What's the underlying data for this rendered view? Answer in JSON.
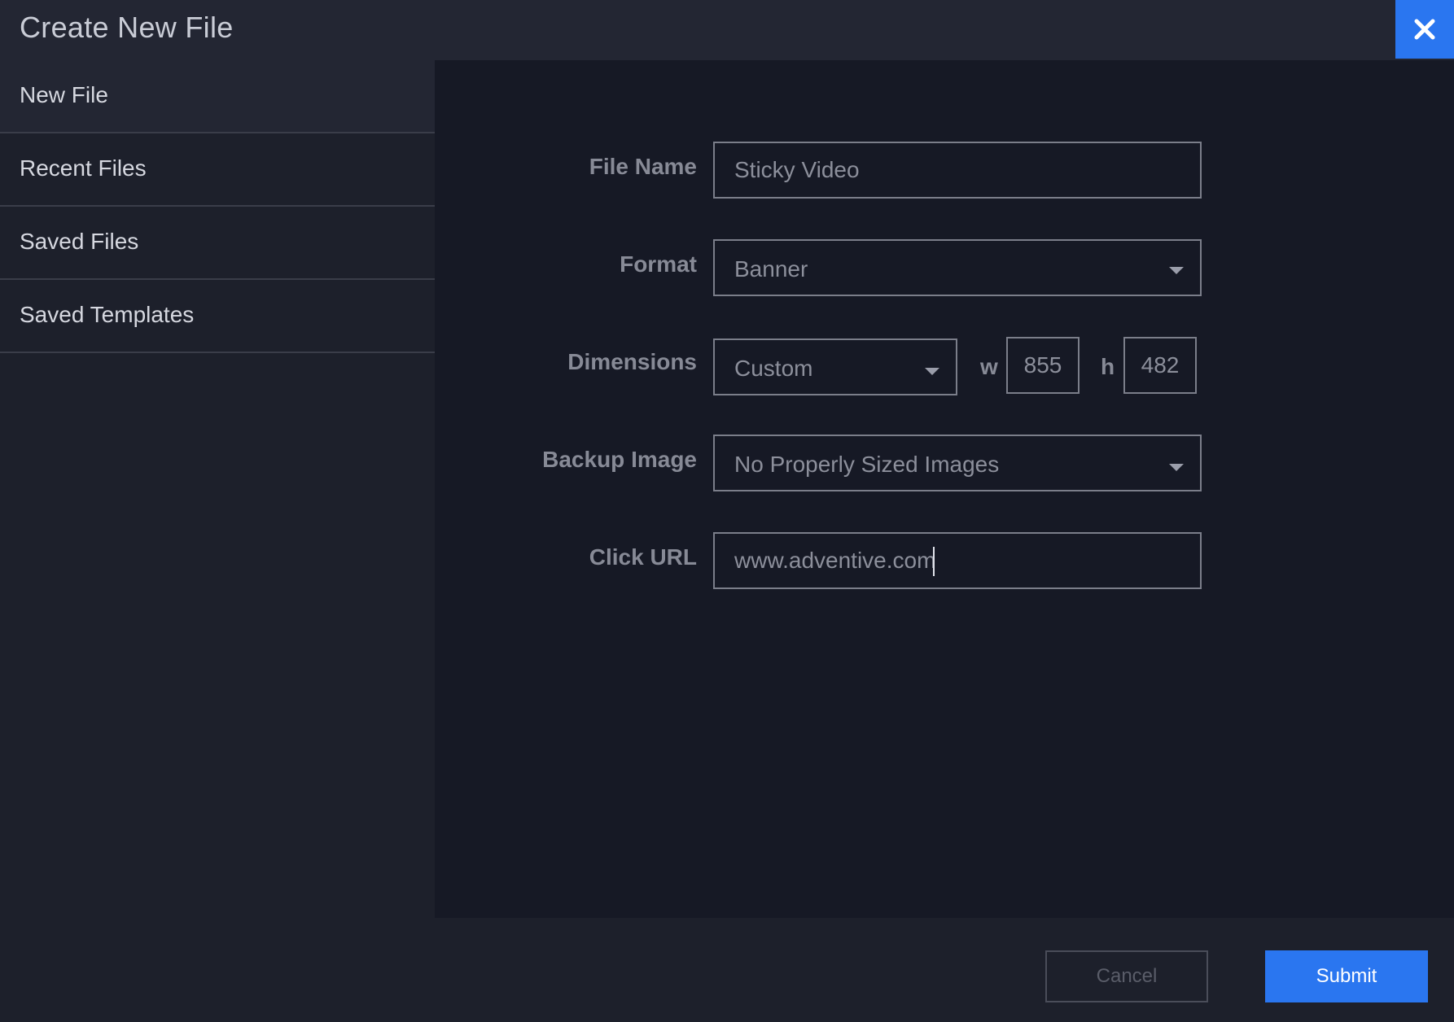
{
  "dialog": {
    "title": "Create New File",
    "close_icon": "close-icon"
  },
  "sidebar": {
    "items": [
      {
        "label": "New File",
        "active": true
      },
      {
        "label": "Recent Files",
        "active": false
      },
      {
        "label": "Saved Files",
        "active": false
      },
      {
        "label": "Saved Templates",
        "active": false
      }
    ]
  },
  "form": {
    "file_name": {
      "label": "File Name",
      "value": "Sticky Video"
    },
    "format": {
      "label": "Format",
      "value": "Banner"
    },
    "dimensions": {
      "label": "Dimensions",
      "preset": "Custom",
      "w_label": "w",
      "w_value": "855",
      "h_label": "h",
      "h_value": "482"
    },
    "backup_image": {
      "label": "Backup Image",
      "value": "No Properly Sized Images"
    },
    "click_url": {
      "label": "Click URL",
      "value": "www.adventive.com"
    }
  },
  "footer": {
    "cancel_label": "Cancel",
    "submit_label": "Submit"
  },
  "colors": {
    "accent": "#2a76f0",
    "background": "#1d202b",
    "panel": "#161925"
  }
}
